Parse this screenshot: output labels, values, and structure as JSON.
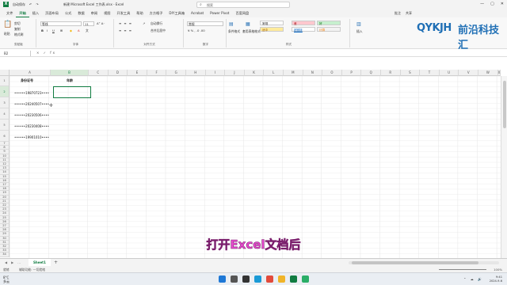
{
  "window": {
    "title": "新建 Microsoft Excel 工作表.xlsx  -  Excel",
    "search_placeholder": "搜索",
    "controls": [
      "—",
      "▢",
      "✕"
    ],
    "quick_access": [
      "自动保存",
      "↶",
      "↷"
    ]
  },
  "tabs": [
    {
      "label": "文件",
      "active": false
    },
    {
      "label": "开始",
      "active": true
    },
    {
      "label": "插入",
      "active": false
    },
    {
      "label": "页面布局",
      "active": false
    },
    {
      "label": "公式",
      "active": false
    },
    {
      "label": "数据",
      "active": false
    },
    {
      "label": "审阅",
      "active": false
    },
    {
      "label": "视图",
      "active": false
    },
    {
      "label": "开发工具",
      "active": false
    },
    {
      "label": "帮助",
      "active": false
    },
    {
      "label": "方方格子",
      "active": false
    },
    {
      "label": "DIY工具箱",
      "active": false
    },
    {
      "label": "Acrobat",
      "active": false
    },
    {
      "label": "Power Pivot",
      "active": false
    },
    {
      "label": "百度网盘",
      "active": false
    }
  ],
  "tabs_right": [
    "批注",
    "共享"
  ],
  "ribbon": {
    "clipboard": {
      "paste": "粘贴",
      "cut": "剪切",
      "copy": "复制",
      "format_painter": "格式刷",
      "label": "剪贴板"
    },
    "font": {
      "name": "等线",
      "size": "11",
      "label": "字体",
      "bold": "B",
      "italic": "I",
      "underline": "U"
    },
    "alignment": {
      "wrap": "自动换行",
      "merge": "合并后居中",
      "label": "对齐方式"
    },
    "number": {
      "format": "常规",
      "label": "数字"
    },
    "styles": {
      "conditional": "条件格式",
      "table_format": "套用表格格式",
      "cells": [
        {
          "text": "常规",
          "bg": "#ffffff",
          "fg": "#222222"
        },
        {
          "text": "差",
          "bg": "#ffc7ce",
          "fg": "#9c0006"
        },
        {
          "text": "好",
          "bg": "#c6efce",
          "fg": "#006100"
        },
        {
          "text": "适中",
          "bg": "#ffeb9c",
          "fg": "#9c5700"
        },
        {
          "text": "超链接",
          "bg": "#ffffff",
          "fg": "#0563c1"
        },
        {
          "text": "计算",
          "bg": "#f2f2f2",
          "fg": "#fa7d00"
        }
      ],
      "label": "样式"
    },
    "cells_group": {
      "insert": "插入"
    }
  },
  "formula_bar": {
    "name_box": "B2",
    "fx": "× ✓ fx",
    "value": ""
  },
  "columns": [
    "A",
    "B",
    "C",
    "D",
    "E",
    "F",
    "G",
    "H",
    "I",
    "J",
    "K",
    "L",
    "M",
    "N",
    "O",
    "P",
    "Q",
    "R",
    "S",
    "T",
    "U",
    "V",
    "W",
    "X",
    "Y"
  ],
  "rows": [
    "1",
    "2",
    "3",
    "4",
    "5",
    "6",
    "7",
    "8",
    "9",
    "10",
    "11",
    "12",
    "13",
    "14",
    "15",
    "16",
    "17",
    "18",
    "19",
    "20",
    "21",
    "22",
    "23",
    "24",
    "25",
    "26",
    "27",
    "28",
    "29",
    "30",
    "31",
    "32",
    "33",
    "34"
  ],
  "cells": {
    "A1": "身份证号",
    "B1": "年龄",
    "A2": "••••••19870723••••",
    "A3": "••••••20240507••••",
    "A4": "••••••20230506••••",
    "A5": "••••••20230408••••",
    "A6": "••••••19901010••••"
  },
  "sheet": {
    "tab": "Sheet1",
    "add": "+",
    "nav": [
      "◀",
      "▶",
      "…"
    ]
  },
  "status": {
    "ready": "就绪",
    "accessibility": "辅助功能: 一切就绪",
    "zoom": "100%"
  },
  "taskbar": {
    "weather_temp": "8°C",
    "weather_desc": "多云",
    "time": "9:41",
    "date": "2024-9-6",
    "icons": [
      {
        "name": "windows-start",
        "color": "#1e78d6"
      },
      {
        "name": "search",
        "color": "#555555"
      },
      {
        "name": "task-view",
        "color": "#333333"
      },
      {
        "name": "edge",
        "color": "#1a9ad6"
      },
      {
        "name": "chrome",
        "color": "#e24a3b"
      },
      {
        "name": "file-explorer",
        "color": "#f0b429"
      },
      {
        "name": "excel",
        "color": "#107c41"
      },
      {
        "name": "wechat",
        "color": "#2aae67"
      }
    ]
  },
  "watermark": {
    "latin": "QYKJH",
    "chinese": "前沿科技汇"
  },
  "subtitle": "打开Excel文档后",
  "colors": {
    "accent": "#107c41",
    "subtitle": "#e94bd0",
    "logo": "#1f6fb5"
  }
}
